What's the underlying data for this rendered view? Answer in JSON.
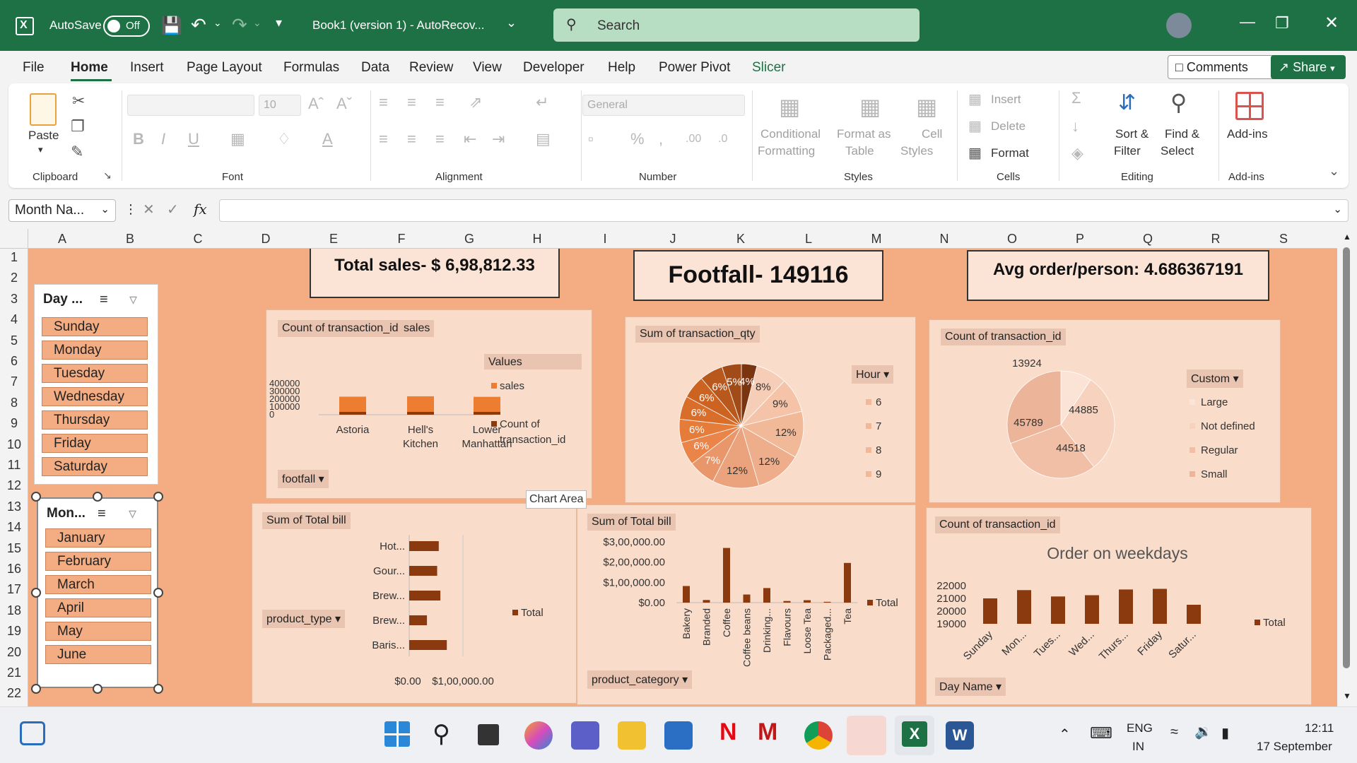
{
  "titlebar": {
    "autosave_label": "AutoSave",
    "autosave_state": "Off",
    "doc_title": "Book1 (version 1)  -  AutoRecov...",
    "search_placeholder": "Search"
  },
  "menu": {
    "tabs": [
      "File",
      "Home",
      "Insert",
      "Page Layout",
      "Formulas",
      "Data",
      "Review",
      "View",
      "Developer",
      "Help",
      "Power Pivot",
      "Slicer"
    ],
    "active": "Home",
    "comments": "Comments",
    "share": "Share"
  },
  "ribbon": {
    "clipboard": {
      "paste": "Paste",
      "group": "Clipboard"
    },
    "font": {
      "size": "10",
      "group": "Font"
    },
    "alignment": {
      "group": "Alignment"
    },
    "number": {
      "format": "General",
      "group": "Number"
    },
    "styles": {
      "conditional": "Conditional",
      "formatting": "Formatting",
      "format_as": "Format as",
      "table": "Table",
      "cell": "Cell",
      "cell_styles": "Styles",
      "group": "Styles"
    },
    "cells": {
      "insert": "Insert",
      "delete": "Delete",
      "format": "Format",
      "group": "Cells"
    },
    "editing": {
      "sort": "Sort &",
      "filter": "Filter",
      "find": "Find &",
      "select": "Select",
      "group": "Editing"
    },
    "addins": {
      "label": "Add-ins",
      "group": "Add-ins"
    }
  },
  "formula_bar": {
    "name_box": "Month Na...",
    "fx": "fx",
    "content": ""
  },
  "grid": {
    "columns": [
      "A",
      "B",
      "C",
      "D",
      "E",
      "F",
      "G",
      "H",
      "I",
      "J",
      "K",
      "L",
      "M",
      "N",
      "O",
      "P",
      "Q",
      "R",
      "S"
    ],
    "rows": [
      "1",
      "2",
      "3",
      "4",
      "5",
      "6",
      "7",
      "8",
      "9",
      "10",
      "11",
      "12",
      "13",
      "14",
      "15",
      "16",
      "17",
      "18",
      "19",
      "20",
      "21",
      "22"
    ]
  },
  "kpis": {
    "total_sales": "Total sales- $ 6,98,812.33",
    "footfall": "Footfall- 149116",
    "avg_order": "Avg order/person: 4.686367191"
  },
  "slicers": {
    "day": {
      "header": "Day ...",
      "items": [
        "Sunday",
        "Monday",
        "Tuesday",
        "Wednesday",
        "Thursday",
        "Friday",
        "Saturday"
      ]
    },
    "month": {
      "header": "Mon...",
      "items": [
        "January",
        "February",
        "March",
        "April",
        "May",
        "June"
      ]
    }
  },
  "tooltip": "Chart Area",
  "pivot_buttons": {
    "chart1_values": [
      "Count of transaction_id",
      "sales"
    ],
    "chart1_values_box": "Values",
    "chart1_axis": "footfall",
    "chart2_value": "Sum of transaction_qty",
    "chart2_legend": "Hour",
    "chart3_value": "Count of transaction_id",
    "chart3_legend": "Custom",
    "chart4_value": "Sum of Total bill",
    "chart4_axis": "product_type",
    "chart5_value": "Sum of Total bill",
    "chart5_axis": "product_category",
    "chart6_value": "Count of transaction_id",
    "chart6_axis": "Day Name"
  },
  "chart_data": [
    {
      "type": "bar",
      "categories": [
        "Astoria",
        "Hell's Kitchen",
        "Lower Manhattan"
      ],
      "series": [
        {
          "name": "Count of transaction_id",
          "values": [
            50000,
            50000,
            50000
          ]
        },
        {
          "name": "sales",
          "values": [
            232000,
            237000,
            230000
          ]
        }
      ],
      "yticks": [
        "400000",
        "300000",
        "200000",
        "100000",
        "0"
      ],
      "ylim": [
        0,
        400000
      ],
      "legend_title": "Values",
      "legend_position": "right",
      "colors": [
        "#8a3a0e",
        "#ed7d31"
      ]
    },
    {
      "type": "pie",
      "legend_title": "Hour",
      "legend_items": [
        "6",
        "7",
        "8",
        "9"
      ],
      "labels": [
        "4%",
        "8%",
        "9%",
        "12%",
        "12%",
        "12%",
        "7%",
        "6%",
        "6%",
        "6%",
        "6%",
        "6%",
        "5%"
      ],
      "values": [
        4,
        8,
        9,
        12,
        12,
        12,
        7,
        6,
        6,
        6,
        6,
        6,
        5
      ],
      "colors": [
        "#7a3510",
        "#f6cdb6",
        "#f5c4a8",
        "#f2b999",
        "#eeae8b",
        "#eaa37c",
        "#e8966a",
        "#ea8448",
        "#e67c3a",
        "#d96e2b",
        "#cc6321",
        "#b8581c",
        "#a14c18"
      ]
    },
    {
      "type": "pie",
      "legend_title": "Custom",
      "legend_items": [
        "Large",
        "Not defined",
        "Regular",
        "Small"
      ],
      "labels": [
        "13924",
        "44885",
        "44518",
        "45789"
      ],
      "values": [
        13924,
        44885,
        44518,
        45789
      ],
      "colors": [
        "#fbe3d6",
        "#f7d2bf",
        "#f0bfa6",
        "#ecb499"
      ]
    },
    {
      "type": "bar",
      "orientation": "horizontal",
      "categories": [
        "Hot...",
        "Gour...",
        "Brew...",
        "Brew...",
        "Baris..."
      ],
      "series": [
        {
          "name": "Total",
          "values": [
            55000,
            52000,
            58000,
            33000,
            70000
          ]
        }
      ],
      "xticks": [
        "$0.00",
        "$1,00,000.00"
      ],
      "xlim": [
        0,
        100000
      ],
      "colors": [
        "#8a3a0e"
      ]
    },
    {
      "type": "bar",
      "categories": [
        "Bakery",
        "Branded",
        "Coffee",
        "Coffee beans",
        "Drinking...",
        "Flavours",
        "Loose Tea",
        "Packaged...",
        "Tea"
      ],
      "series": [
        {
          "name": "Total",
          "values": [
            82000,
            13000,
            270000,
            40000,
            72000,
            8000,
            12000,
            4000,
            196000
          ]
        }
      ],
      "yticks": [
        "$3,00,000.00",
        "$2,00,000.00",
        "$1,00,000.00",
        "$0.00"
      ],
      "ylim": [
        0,
        300000
      ],
      "colors": [
        "#8a3a0e"
      ]
    },
    {
      "type": "bar",
      "title": "Order on weekdays",
      "categories": [
        "Sunday",
        "Mon...",
        "Tues...",
        "Wed...",
        "Thurs...",
        "Friday",
        "Satur..."
      ],
      "series": [
        {
          "name": "Total",
          "values": [
            21000,
            21650,
            21150,
            21250,
            21700,
            21750,
            20500
          ]
        }
      ],
      "yticks": [
        "22000",
        "21000",
        "20000",
        "19000"
      ],
      "ylim": [
        19000,
        22000
      ],
      "colors": [
        "#8a3a0e"
      ]
    }
  ],
  "taskbar": {
    "lang": "ENG",
    "region": "IN",
    "time": "12:11",
    "date": "17 September"
  }
}
